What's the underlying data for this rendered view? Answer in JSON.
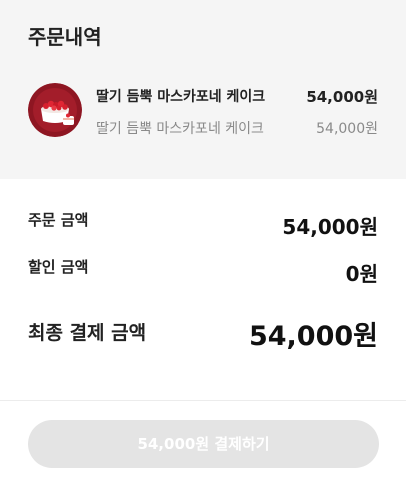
{
  "order": {
    "title": "주문내역",
    "product": {
      "name": "딸기 듬뿍 마스카포네 케이크",
      "price": "54,000원",
      "option_name": "딸기 듬뿍 마스카포네 케이크",
      "option_price": "54,000원",
      "thumbnail_icon": "strawberry-cake-icon"
    }
  },
  "summary": {
    "order_amount_label": "주문 금액",
    "order_amount_value": "54,000원",
    "discount_label": "할인 금액",
    "discount_value": "0원",
    "total_label": "최종 결제 금액",
    "total_value": "54,000원"
  },
  "actions": {
    "pay_button_label": "54,000원 결제하기"
  },
  "colors": {
    "section_bg": "#f5f5f5",
    "thumb_bg": "#8e1622",
    "button_disabled_bg": "#e4e4e4"
  }
}
